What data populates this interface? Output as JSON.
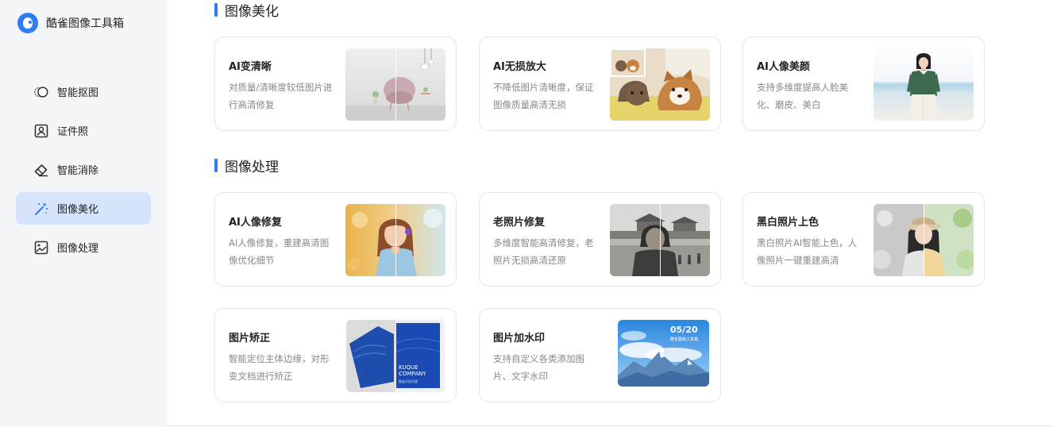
{
  "app": {
    "name": "酷雀图像工具箱"
  },
  "sidebar": {
    "items": [
      {
        "label": "智能抠图",
        "icon": "cutout-icon",
        "active": false
      },
      {
        "label": "证件照",
        "icon": "id-photo-icon",
        "active": false
      },
      {
        "label": "智能消除",
        "icon": "eraser-icon",
        "active": false
      },
      {
        "label": "图像美化",
        "icon": "magic-wand-icon",
        "active": true
      },
      {
        "label": "图像处理",
        "icon": "image-process-icon",
        "active": false
      }
    ]
  },
  "sections": [
    {
      "title": "图像美化",
      "cards": [
        {
          "title": "AI变清晰",
          "desc": "对质量/清晰度较低图片进行高清修复"
        },
        {
          "title": "AI无损放大",
          "desc": "不降低图片清晰度，保证图像质量高清无损"
        },
        {
          "title": "AI人像美颜",
          "desc": "支持多维度提高人脸美化、磨皮、美白"
        }
      ]
    },
    {
      "title": "图像处理",
      "cards": [
        {
          "title": "AI人像修复",
          "desc": "AI人像修复，重建高清图像优化细节"
        },
        {
          "title": "老照片修复",
          "desc": "多维度智能高清修复，老照片无损高清还原"
        },
        {
          "title": "黑白照片上色",
          "desc": "黑白照片AI智能上色，人像照片一键重建高清"
        },
        {
          "title": "图片矫正",
          "desc": "智能定位主体边缘，对形变文档进行矫正"
        },
        {
          "title": "图片加水印",
          "desc": "支持自定义各类添加图片、文字水印"
        }
      ]
    }
  ],
  "thumbnails": {
    "correction_text_1": "KUQUE",
    "correction_text_2": "COMPANY",
    "correction_text_3": "酷雀文档扫描",
    "watermark_date": "05/20",
    "watermark_sub": "酷雀图像工具箱"
  },
  "colors": {
    "accent": "#2f7cf6",
    "sidebar_bg": "#f3f5f9",
    "active_bg": "#d6e4fb"
  }
}
